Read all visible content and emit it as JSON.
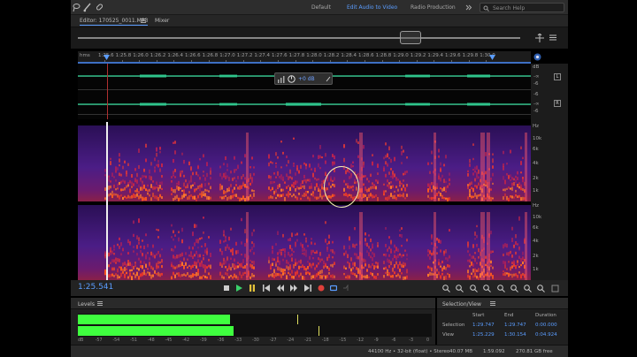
{
  "workspaces": [
    "Default",
    "Edit Audio to Video",
    "Radio Production"
  ],
  "active_workspace": 1,
  "search": {
    "placeholder": "Search Help"
  },
  "editor": {
    "tab_label": "Editor: 170525_0011.MP3",
    "mixer_label": "Mixer"
  },
  "ruler": {
    "unit": "hms",
    "labels": [
      "1:25.6",
      "1:25.8",
      "1:26.0",
      "1:26.2",
      "1:26.4",
      "1:26.6",
      "1:26.8",
      "1:27.0",
      "1:27.2",
      "1:27.4",
      "1:27.6",
      "1:27.8",
      "1:28.0",
      "1:28.2",
      "1:28.4",
      "1:28.6",
      "1:28.8",
      "1:29.0",
      "1:29.2",
      "1:29.4",
      "1:29.6",
      "1:29.8",
      "1:30.0"
    ]
  },
  "hud": {
    "volume": "+0 dB"
  },
  "waveform_scale": {
    "top_label": "dB",
    "ch_left": "L",
    "ch_right": "R",
    "labels": [
      "-∞",
      "-6",
      "-∞",
      "-6",
      "-6",
      "-∞",
      "-6"
    ]
  },
  "spectral_scale": {
    "unit": "Hz",
    "labels_top": [
      "10k",
      "6k",
      "4k",
      "2k",
      "1k"
    ],
    "labels_bottom": [
      "10k",
      "6k",
      "4k",
      "2k",
      "1k"
    ]
  },
  "transport": {
    "timecode": "1:25.541"
  },
  "levels": {
    "title": "Levels",
    "scale": [
      "dB",
      "-57",
      "-54",
      "-51",
      "-48",
      "-45",
      "-42",
      "-39",
      "-36",
      "-33",
      "-30",
      "-27",
      "-24",
      "-21",
      "-18",
      "-15",
      "-12",
      "-9",
      "-6",
      "-3",
      "0"
    ],
    "left_level": 0.43,
    "right_level": 0.44,
    "left_peak": 0.62,
    "right_peak": 0.68
  },
  "selection_view": {
    "title": "Selection/View",
    "headers": [
      "Start",
      "End",
      "Duration"
    ],
    "rows": [
      {
        "label": "Selection",
        "start": "1:29.747",
        "end": "1:29.747",
        "duration": "0:00.000"
      },
      {
        "label": "View",
        "start": "1:25.229",
        "end": "1:30.154",
        "duration": "0:04.924"
      }
    ]
  },
  "status": {
    "format": "44100 Hz • 32-bit (float) • Stereo",
    "size": "40.07 MB",
    "duration": "1:59.092",
    "free": "270.81 GB free"
  },
  "colors": {
    "accent": "#5b9dff",
    "meter": "#3fff3f",
    "annotation": "#f3efb0"
  }
}
